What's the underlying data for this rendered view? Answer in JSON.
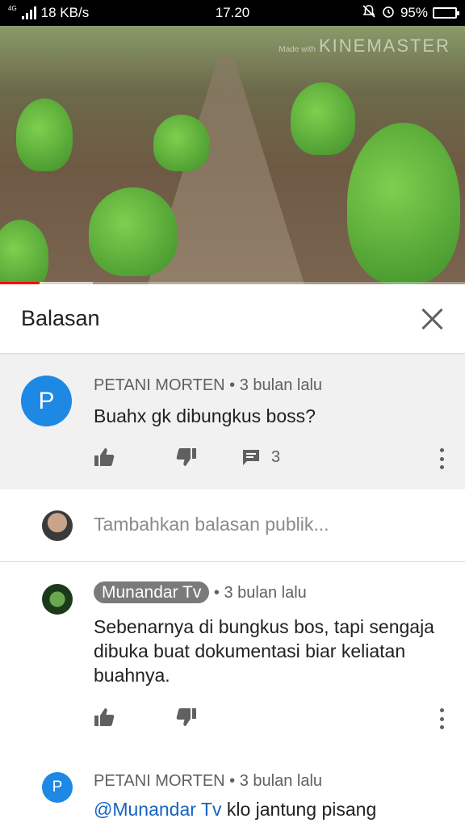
{
  "status_bar": {
    "network": "4G",
    "speed": "18 KB/s",
    "time": "17.20",
    "battery": "95%"
  },
  "video": {
    "watermark_small": "Made with",
    "watermark": "KINEMASTER",
    "progress": 0.085,
    "buffered": 0.2
  },
  "panel": {
    "title": "Balasan"
  },
  "parent_comment": {
    "avatar_letter": "P",
    "avatar_color": "#1e88e5",
    "author": "PETANI MORTEN",
    "time": "3 bulan lalu",
    "text": "Buahx gk dibungkus boss?",
    "reply_count": "3"
  },
  "reply_box": {
    "placeholder": "Tambahkan balasan publik..."
  },
  "replies": [
    {
      "author": "Munandar Tv",
      "time": "3 bulan lalu",
      "text": "Sebenarnya di bungkus bos, tapi sengaja dibuka buat dokumentasi biar keliatan buahnya."
    },
    {
      "avatar_letter": "P",
      "author": "PETANI MORTEN",
      "time": "3 bulan lalu",
      "mention": "@Munandar Tv",
      "text": "klo jantung pisang"
    }
  ],
  "separator": "•"
}
